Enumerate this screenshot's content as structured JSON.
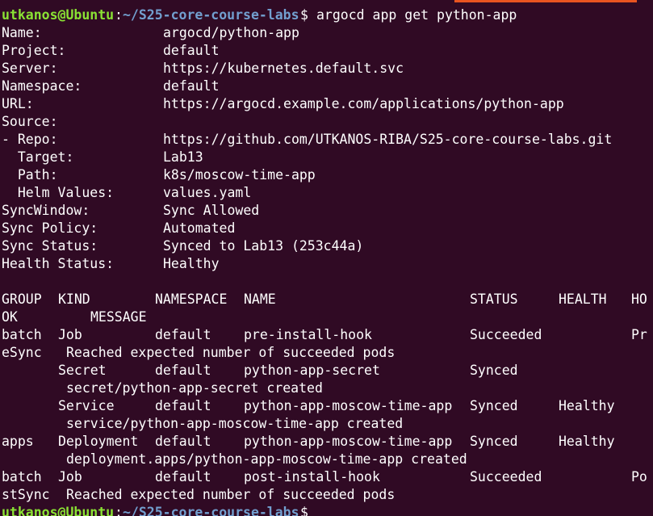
{
  "prompt": {
    "user_host": "utkanos@Ubuntu",
    "separator": ":",
    "path": "~/S25-core-course-labs",
    "symbol": "$"
  },
  "command": "argocd app get python-app",
  "details": {
    "name_label": "Name:",
    "name_value": "argocd/python-app",
    "project_label": "Project:",
    "project_value": "default",
    "server_label": "Server:",
    "server_value": "https://kubernetes.default.svc",
    "namespace_label": "Namespace:",
    "namespace_value": "default",
    "url_label": "URL:",
    "url_value": "https://argocd.example.com/applications/python-app",
    "source_label": "Source:",
    "repo_label": "- Repo:",
    "repo_value": "https://github.com/UTKANOS-RIBA/S25-core-course-labs.git",
    "target_label": "  Target:",
    "target_value": "Lab13",
    "path_label": "  Path:",
    "path_value": "k8s/moscow-time-app",
    "helm_label": "  Helm Values:",
    "helm_value": "values.yaml",
    "syncwindow_label": "SyncWindow:",
    "syncwindow_value": "Sync Allowed",
    "syncpolicy_label": "Sync Policy:",
    "syncpolicy_value": "Automated",
    "syncstatus_label": "Sync Status:",
    "syncstatus_value": "Synced to Lab13 (253c44a)",
    "health_label": "Health Status:",
    "health_value": "Healthy"
  },
  "table": {
    "headers": {
      "group": "GROUP",
      "kind": "KIND",
      "namespace": "NAMESPACE",
      "name": "NAME",
      "status": "STATUS",
      "health": "HEALTH",
      "hook_start": "HO",
      "hook_end": "OK",
      "message": "MESSAGE"
    },
    "rows": [
      {
        "group": "batch",
        "kind": "Job",
        "namespace": "default",
        "name": "pre-install-hook",
        "status": "Succeeded",
        "health": "",
        "hook_start": "Pr",
        "hook_end": "eSync",
        "message": "Reached expected number of succeeded pods"
      },
      {
        "group": "",
        "kind": "Secret",
        "namespace": "default",
        "name": "python-app-secret",
        "status": "Synced",
        "health": "",
        "hook_start": "",
        "hook_end": "",
        "message": "secret/python-app-secret created"
      },
      {
        "group": "",
        "kind": "Service",
        "namespace": "default",
        "name": "python-app-moscow-time-app",
        "status": "Synced",
        "health": "Healthy",
        "hook_start": "",
        "hook_end": "",
        "message": "service/python-app-moscow-time-app created"
      },
      {
        "group": "apps",
        "kind": "Deployment",
        "namespace": "default",
        "name": "python-app-moscow-time-app",
        "status": "Synced",
        "health": "Healthy",
        "hook_start": "",
        "hook_end": "",
        "message": "deployment.apps/python-app-moscow-time-app created"
      },
      {
        "group": "batch",
        "kind": "Job",
        "namespace": "default",
        "name": "post-install-hook",
        "status": "Succeeded",
        "health": "",
        "hook_start": "Po",
        "hook_end": "stSync",
        "message": "Reached expected number of succeeded pods"
      }
    ]
  },
  "colors": {
    "background": "#300a24",
    "text": "#ffffff",
    "prompt_user": "#8ae234",
    "prompt_path": "#729fcf",
    "accent": "#e95420"
  }
}
